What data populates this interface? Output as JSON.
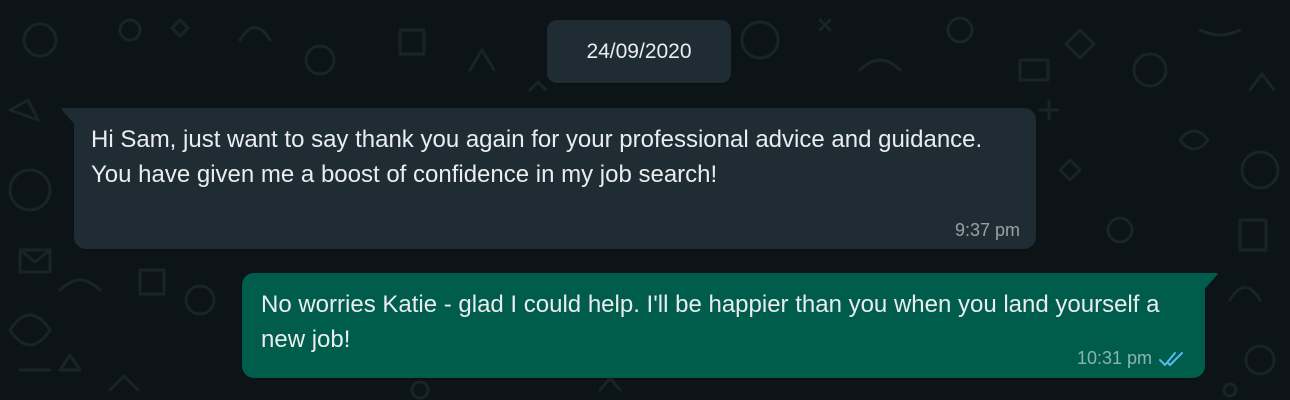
{
  "chat": {
    "date_divider": "24/09/2020",
    "messages": [
      {
        "direction": "incoming",
        "text": "Hi Sam, just want to say thank you again for your professional advice and guidance.  You have given me a boost of confidence in my job search!",
        "time": "9:37 pm"
      },
      {
        "direction": "outgoing",
        "text": "No worries Katie - glad I could help. I'll be happier than you when you land yourself a new job!",
        "time": "10:31 pm",
        "status_icon": "double-check-read-icon"
      }
    ]
  },
  "colors": {
    "background": "#0d1418",
    "incoming_bubble": "#1f2c33",
    "outgoing_bubble": "#005c4b",
    "text": "#e9edef",
    "read_ticks": "#53bdeb"
  }
}
